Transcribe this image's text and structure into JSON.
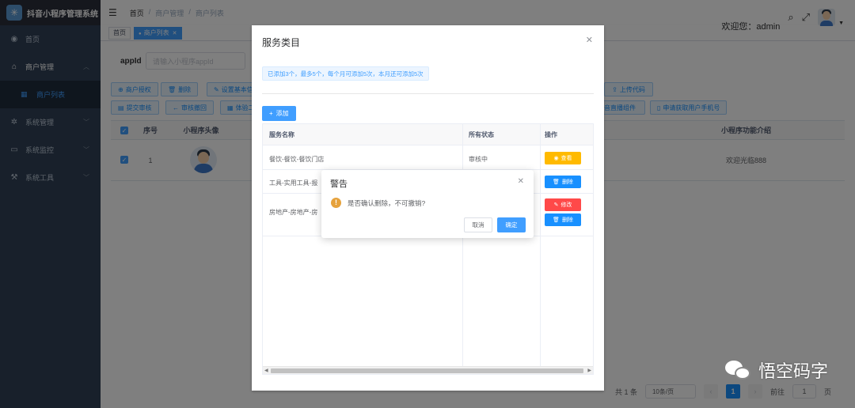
{
  "app": {
    "title": "抖音小程序管理系统"
  },
  "sidebar": {
    "items": [
      {
        "icon": "dashboard-icon",
        "label": "首页"
      },
      {
        "icon": "merchant-icon",
        "label": "商户管理",
        "expanded": true,
        "children": [
          {
            "icon": "list-icon",
            "label": "商户列表",
            "active": true
          }
        ]
      },
      {
        "icon": "gear-icon",
        "label": "系统管理"
      },
      {
        "icon": "monitor-icon",
        "label": "系统监控"
      },
      {
        "icon": "tool-icon",
        "label": "系统工具"
      }
    ]
  },
  "navbar": {
    "breadcrumb": [
      "首页",
      "商户管理",
      "商户列表"
    ],
    "welcome": "欢迎您：admin"
  },
  "tags": [
    {
      "label": "首页"
    },
    {
      "label": "商户列表",
      "active": true
    }
  ],
  "search": {
    "label": "appId",
    "placeholder": "请输入小程序appId"
  },
  "toolbar": {
    "row1": [
      "商户授权",
      "删除",
      "设置基本信",
      "上传代码"
    ],
    "row2": [
      "提交审核",
      "审核撤回",
      "体验二",
      "音直播组件",
      "申请获取用户手机号"
    ]
  },
  "table": {
    "headers": [
      "序号",
      "小程序头像",
      "小程序功能介绍"
    ],
    "rows": [
      {
        "index": "1",
        "intro": "欢迎光临888",
        "checked": true
      }
    ]
  },
  "pager": {
    "total": "共 1 条",
    "size": "10条/页",
    "current": "1",
    "goto": "前往",
    "goto_value": "1",
    "page_unit": "页"
  },
  "dialog": {
    "title": "服务类目",
    "info": "已添加3个，最多5个，每个月可添加5次，本月还可添加5次",
    "add_label": "添加",
    "headers": [
      "服务名称",
      "所有状态",
      "操作"
    ],
    "rows": [
      {
        "name": "餐饮-餐饮-餐饮门店",
        "status": "审核中",
        "actions": [
          "查看"
        ]
      },
      {
        "name": "工具-实用工具-报",
        "status": "",
        "actions": [
          "删除"
        ]
      },
      {
        "name": "房地产-房地产-房",
        "status": "",
        "actions": [
          "修改",
          "删除"
        ]
      }
    ]
  },
  "msgbox": {
    "title": "警告",
    "message": "是否确认删除，不可撤销?",
    "cancel": "取消",
    "confirm": "确定"
  },
  "watermark": {
    "text": "悟空码字"
  }
}
